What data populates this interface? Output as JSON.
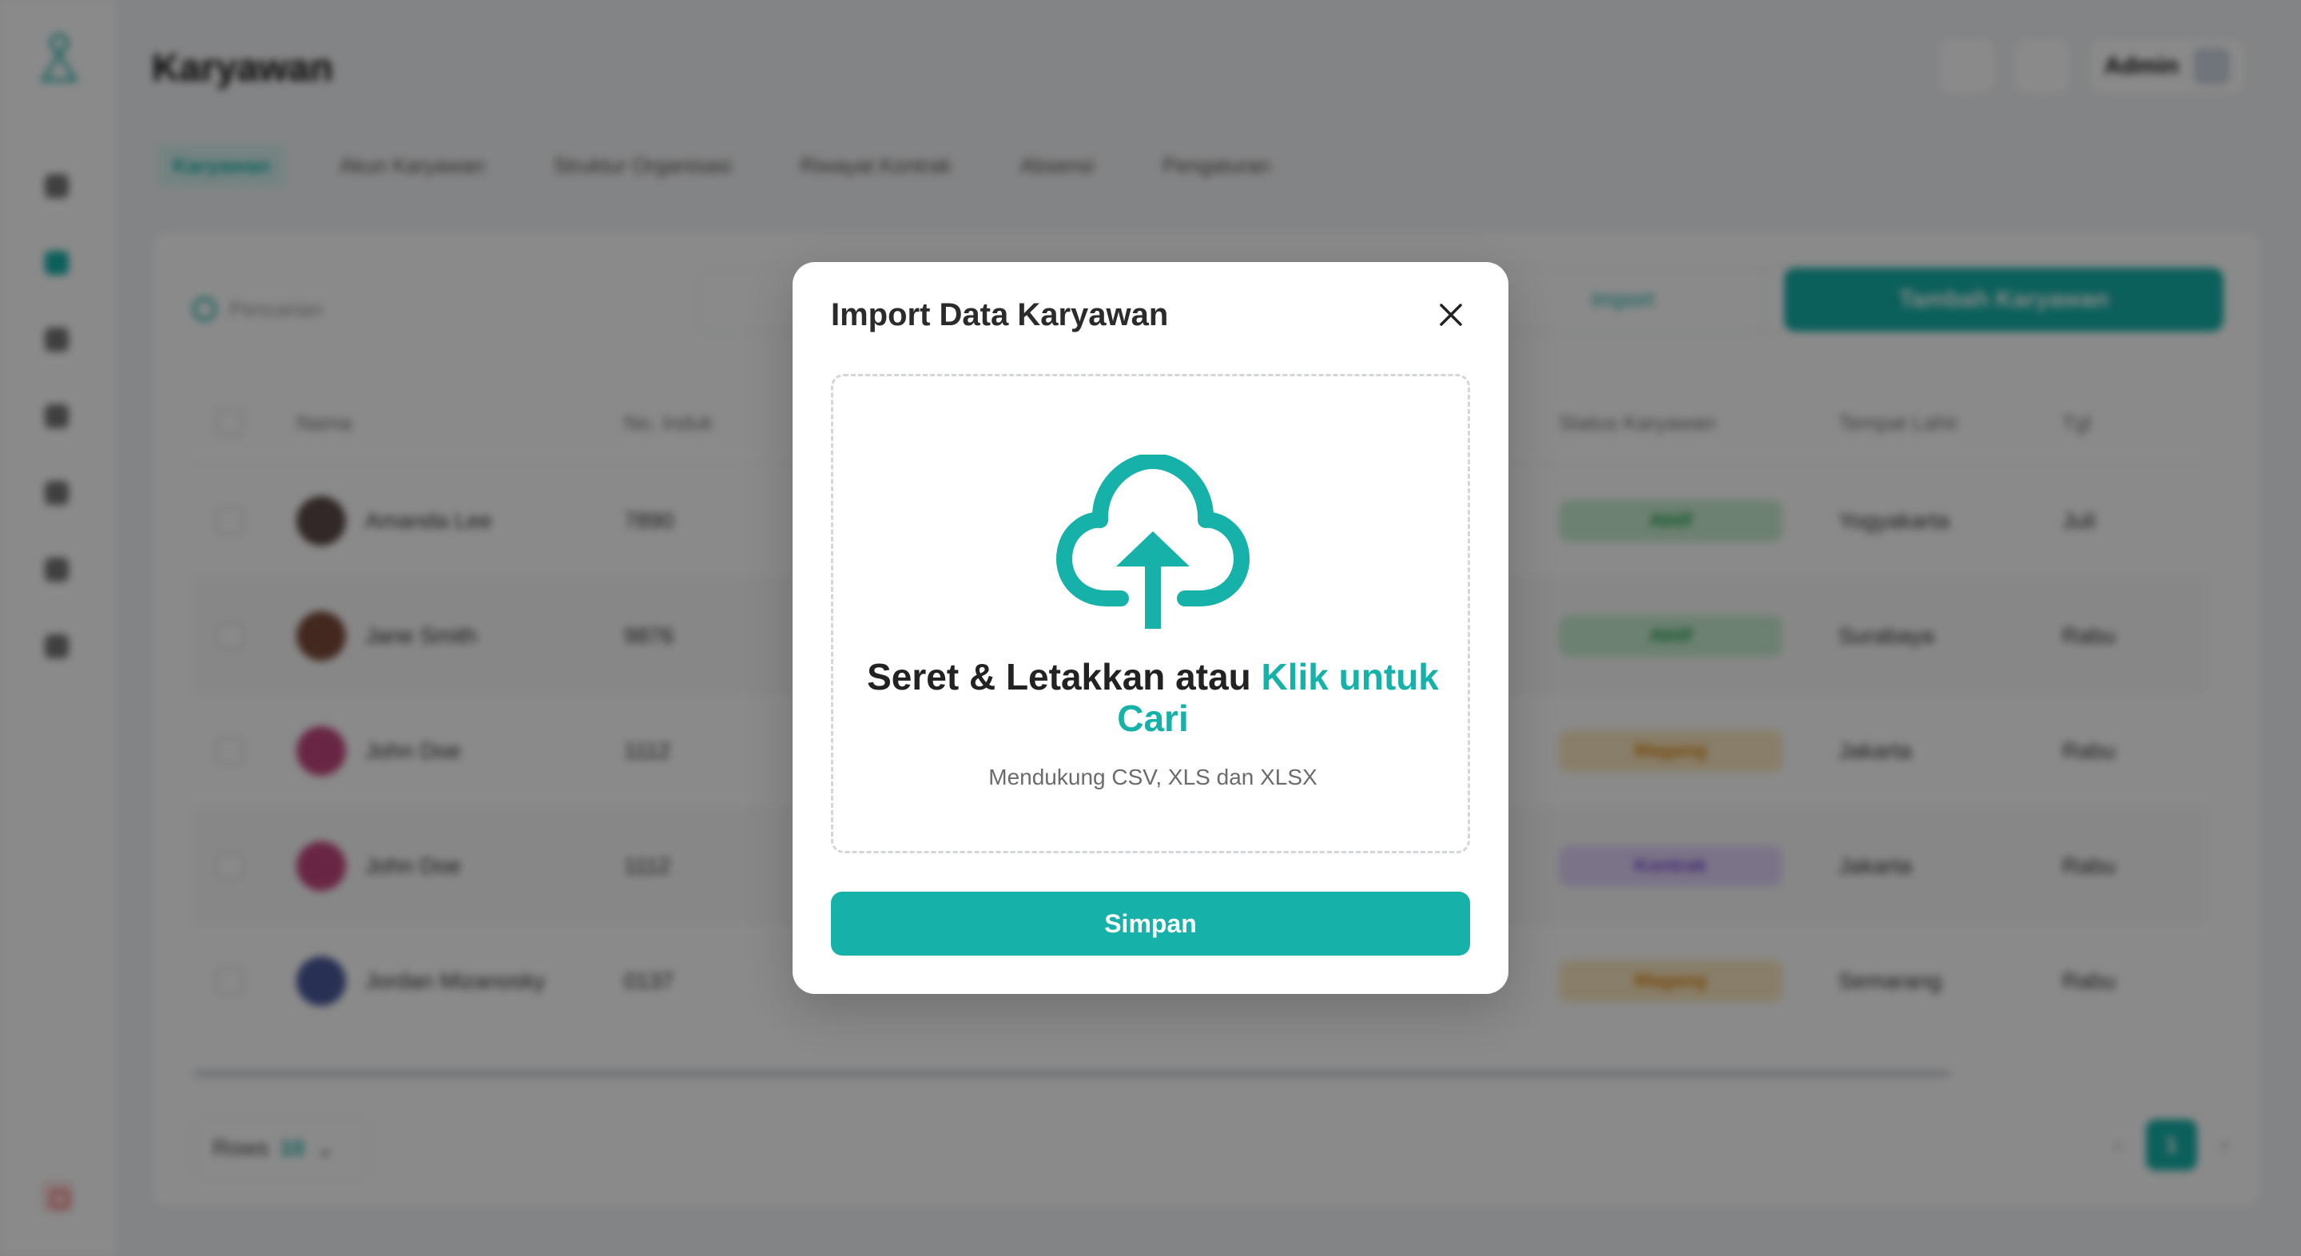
{
  "app": {
    "page_title": "Karyawan",
    "user_name": "Admin",
    "tabs": [
      {
        "label": "Karyawan"
      },
      {
        "label": "Akun Karyawan"
      },
      {
        "label": "Struktur Organisasi"
      },
      {
        "label": "Riwayat Kontrak"
      },
      {
        "label": "Absensi"
      },
      {
        "label": "Pengaturan"
      }
    ],
    "search_placeholder": "Pencarian",
    "import_label": "Import",
    "add_button": "Tambah Karyawan",
    "columns": [
      "Nama",
      "No. Induk",
      "Status Karyawan",
      "Tempat Lahir",
      "Tgl"
    ],
    "rows": [
      {
        "name": "Amanda Lee",
        "id": "7890",
        "status": "Aktif",
        "status_type": "aktif",
        "place": "Yogyakarta",
        "date": "Juli"
      },
      {
        "name": "Jane Smith",
        "id": "9876",
        "status": "Aktif",
        "status_type": "aktif",
        "place": "Surabaya",
        "date": "Rabu"
      },
      {
        "name": "John Doe",
        "id": "1112",
        "status": "Magang",
        "status_type": "magang",
        "place": "Jakarta",
        "date": "Rabu"
      },
      {
        "name": "John Doe",
        "id": "1112",
        "status": "Kontrak",
        "status_type": "kontrak",
        "place": "Jakarta",
        "date": "Rabu"
      },
      {
        "name": "Jordan Mizanosky",
        "id": "0137",
        "status": "Magang",
        "status_type": "magang",
        "place": "Semarang",
        "date": "Rabu"
      }
    ],
    "rows_label": "Rows",
    "rows_value": "10",
    "current_page": "1"
  },
  "modal": {
    "title": "Import Data Karyawan",
    "close_icon": "close-icon",
    "upload_icon": "cloud-upload-icon",
    "drop_text_main": "Seret & Letakkan atau ",
    "drop_text_link": "Klik untuk Cari",
    "supported_formats": "Mendukung CSV, XLS dan XLSX",
    "save_button": "Simpan"
  },
  "colors": {
    "accent": "#16b1a9",
    "overlay": "rgba(0,0,0,0.46)",
    "badge_aktif": "#c9eed2",
    "badge_magang": "#fde9c2",
    "badge_kontrak": "#e4d7fb"
  }
}
